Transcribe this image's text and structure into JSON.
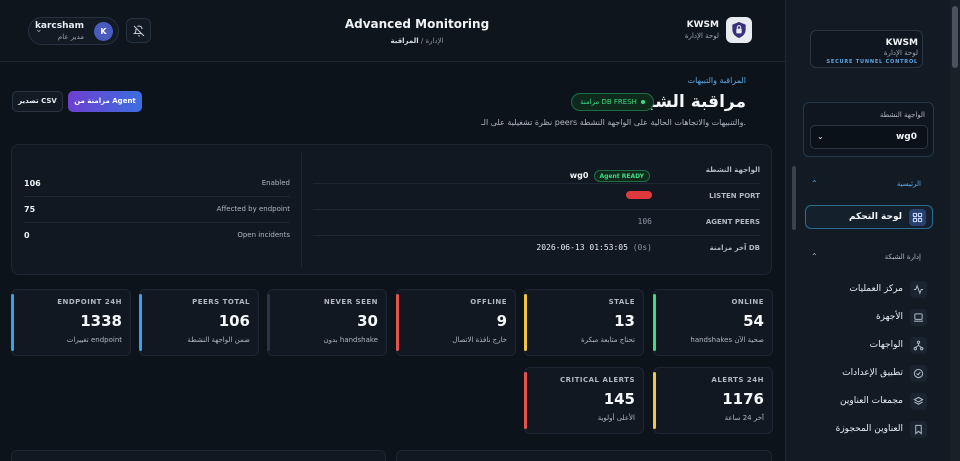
{
  "user": {
    "name": "karcsham",
    "role": "مدير عام",
    "initial": "K"
  },
  "header": {
    "title": "Advanced Monitoring",
    "crumb_parent": "الإدارة",
    "crumb_sep": "/",
    "crumb_current": "المراقبة"
  },
  "brand": {
    "name": "KWSM",
    "subtitle": "لوحة الإدارة",
    "tagline": "SECURE TUNNEL CONTROL"
  },
  "page": {
    "section_label": "المراقبة والتبيهات",
    "title": "مراقبة الشبكة",
    "sync_badge": "مزامنة DB FRESH",
    "description": "نظرة تشغيلية على الـ peers والتنبيهات والاتجاهات الحالية على الواجهة النشطة.",
    "agent_button": "مزامنة من Agent",
    "csv_button": "تصدير CSV"
  },
  "overview": {
    "active_interface_label": "الواجهة النشطة",
    "active_interface_value": "wg0",
    "agent_status": "Agent READY",
    "listen_port_label": "LISTEN PORT",
    "agent_peers_label": "AGENT PEERS",
    "agent_peers_value": "106",
    "last_sync_label": "آخر مزامنة DB",
    "last_sync_value": "2026-06-13 01:53:05",
    "last_sync_age": "(0s)",
    "stats": [
      {
        "label": "Enabled",
        "value": "106"
      },
      {
        "label": "Affected by endpoint",
        "value": "75"
      },
      {
        "label": "Open incidents",
        "value": "0"
      }
    ]
  },
  "cards": [
    {
      "title": "ONLINE",
      "value": "54",
      "sub": "handshakes صحية الآن",
      "color": "#3ddc84"
    },
    {
      "title": "STALE",
      "value": "13",
      "sub": "تحتاج متابعة مبكرة",
      "color": "#f5c542"
    },
    {
      "title": "OFFLINE",
      "value": "9",
      "sub": "خارج نافذة الاتصال",
      "color": "#e5534b"
    },
    {
      "title": "NEVER SEEN",
      "value": "30",
      "sub": "بدون handshake",
      "color": "#2a3544"
    },
    {
      "title": "PEERS TOTAL",
      "value": "106",
      "sub": "ضمن الواجهة النشطة",
      "color": "#3aa0e8"
    },
    {
      "title": "ENDPOINT 24H",
      "value": "1338",
      "sub": "تغييرات endpoint",
      "color": "#3aa0e8"
    },
    {
      "title": "ALERTS 24H",
      "value": "1176",
      "sub": "آخر 24 ساعة",
      "color": "#f5c542"
    },
    {
      "title": "CRITICAL ALERTS",
      "value": "145",
      "sub": "الأعلى أولوية",
      "color": "#e5534b"
    }
  ],
  "sidebar": {
    "iface_label": "الواجهة النشطة",
    "iface_value": "wg0",
    "group_main": "الرئيسية",
    "dashboard": "لوحة التحكم",
    "group_network": "إدارة الشبكة",
    "items": [
      {
        "label": "مركز العمليات",
        "icon": "activity-icon"
      },
      {
        "label": "الأجهزة",
        "icon": "devices-icon"
      },
      {
        "label": "الواجهات",
        "icon": "network-icon"
      },
      {
        "label": "تطبيق الإعدادات",
        "icon": "check-circle-icon"
      },
      {
        "label": "مجمعات العناوين",
        "icon": "layers-icon"
      },
      {
        "label": "العناوين المحجوزة",
        "icon": "bookmark-icon"
      }
    ]
  },
  "colors": {
    "accent": "#5aa9e6",
    "success": "#3ddc84",
    "warning": "#f5c542",
    "danger": "#e5534b"
  }
}
